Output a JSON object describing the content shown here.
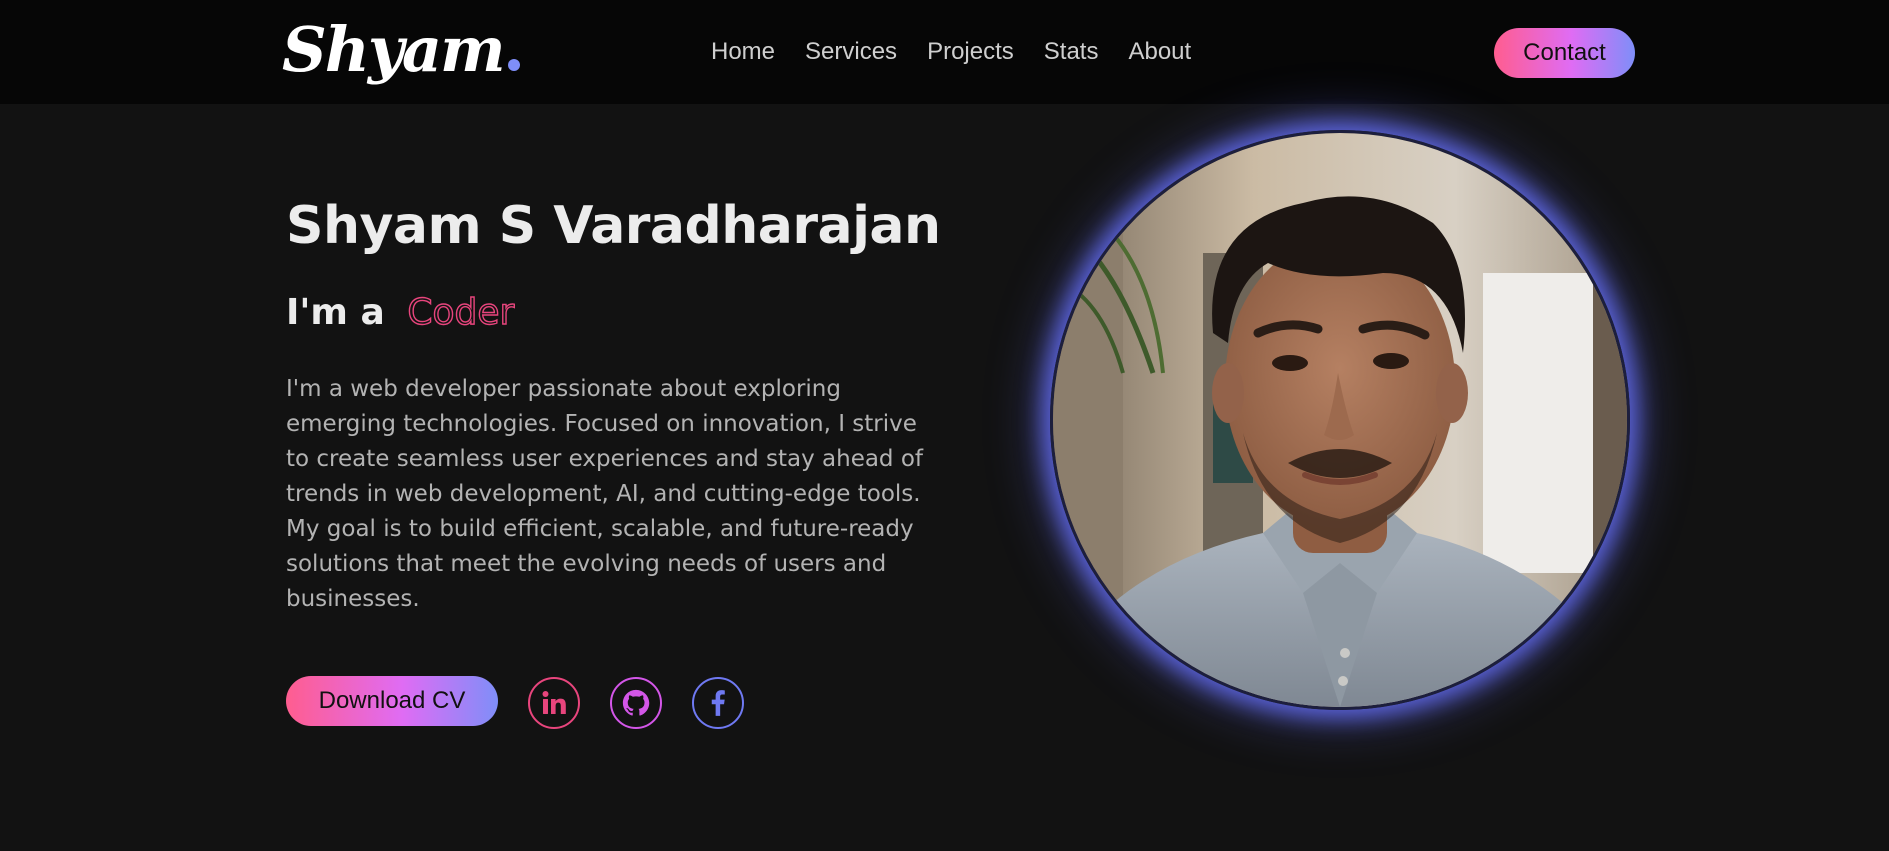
{
  "header": {
    "logo_text": "Shyam",
    "nav": [
      "Home",
      "Services",
      "Projects",
      "Stats",
      "About"
    ],
    "contact_label": "Contact"
  },
  "hero": {
    "name": "Shyam S Varadharajan",
    "intro_prefix": "I'm a",
    "role": "Coder",
    "bio": "I'm a web developer passionate about exploring emerging technologies. Focused on innovation, I strive to create seamless user experiences and stay ahead of trends in web development, AI, and cutting-edge tools. My goal is to build efficient, scalable, and future-ready solutions that meet the evolving needs of users and businesses.",
    "download_label": "Download CV",
    "socials": [
      {
        "name": "linkedin",
        "icon": "linkedin-icon",
        "color": "#e8457d"
      },
      {
        "name": "github",
        "icon": "github-icon",
        "color": "#d356e8"
      },
      {
        "name": "facebook",
        "icon": "facebook-icon",
        "color": "#6f79f2"
      }
    ]
  },
  "colors": {
    "gradient_start": "#ff5d8f",
    "gradient_mid": "#df6cf4",
    "gradient_end": "#7f8ef8",
    "portrait_glow": "#5a62d8",
    "background": "#121212",
    "header_background": "#060606"
  }
}
